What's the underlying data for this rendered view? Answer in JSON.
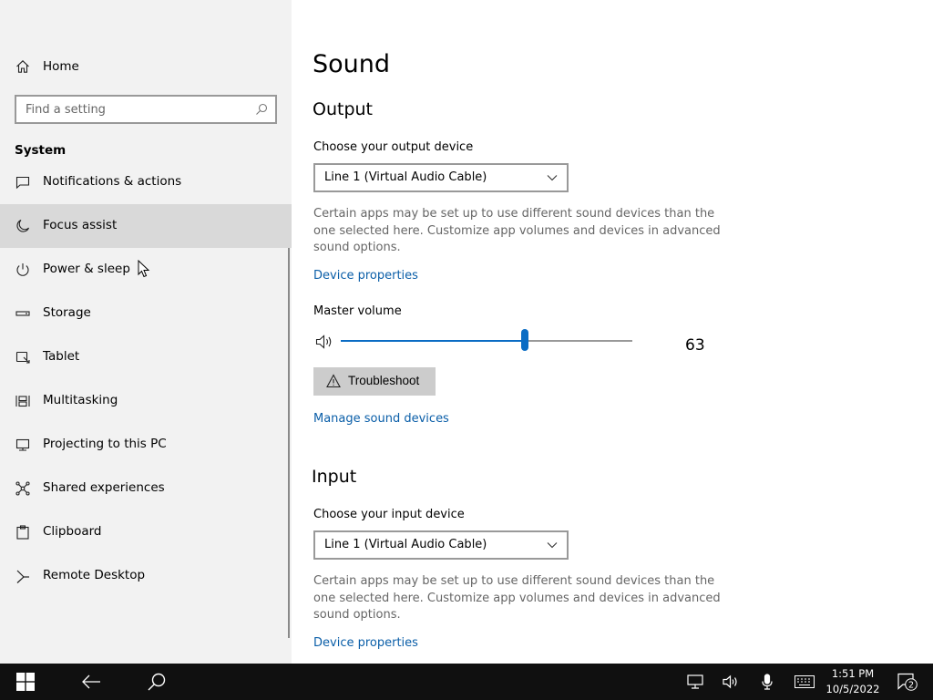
{
  "sidebar": {
    "home_label": "Home",
    "search_placeholder": "Find a setting",
    "section_title": "System",
    "items": [
      {
        "label": "Notifications & actions",
        "icon": "notifications-icon"
      },
      {
        "label": "Focus assist",
        "icon": "moon-icon",
        "selected": true
      },
      {
        "label": "Power & sleep",
        "icon": "power-icon"
      },
      {
        "label": "Storage",
        "icon": "storage-icon"
      },
      {
        "label": "Tablet",
        "icon": "tablet-icon"
      },
      {
        "label": "Multitasking",
        "icon": "multitasking-icon"
      },
      {
        "label": "Projecting to this PC",
        "icon": "projector-icon"
      },
      {
        "label": "Shared experiences",
        "icon": "shared-icon"
      },
      {
        "label": "Clipboard",
        "icon": "clipboard-icon"
      },
      {
        "label": "Remote Desktop",
        "icon": "remote-desktop-icon"
      }
    ]
  },
  "main": {
    "page_title": "Sound",
    "output": {
      "heading": "Output",
      "choose_label": "Choose your output device",
      "device": "Line 1 (Virtual Audio Cable)",
      "description": "Certain apps may be set up to use different sound devices than the one selected here. Customize app volumes and devices in advanced sound options.",
      "device_properties_link": "Device properties",
      "master_volume_label": "Master volume",
      "volume": 63,
      "troubleshoot_label": "Troubleshoot",
      "manage_link": "Manage sound devices"
    },
    "input": {
      "heading": "Input",
      "choose_label": "Choose your input device",
      "device": "Line 1 (Virtual Audio Cable)",
      "description": "Certain apps may be set up to use different sound devices than the one selected here. Customize app volumes and devices in advanced sound options.",
      "device_properties_link": "Device properties"
    }
  },
  "taskbar": {
    "time": "1:51 PM",
    "date": "10/5/2022",
    "notification_count": "2"
  },
  "colors": {
    "accent": "#0a6cc4",
    "link": "#0a5ea8",
    "sidebar_bg": "#f2f2f2",
    "selected_bg": "#d9d9d9",
    "taskbar_bg": "#101010"
  }
}
